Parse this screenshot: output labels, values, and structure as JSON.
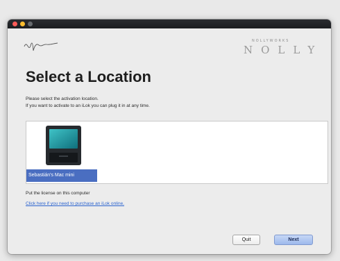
{
  "window": {
    "traffic_lights": [
      "close",
      "minimize",
      "maximize"
    ]
  },
  "brand": {
    "sub": "NOLLYWORKS",
    "name": "NOLLY"
  },
  "dialog": {
    "title": "Select a Location",
    "description_line1": "Please select the activation location.",
    "description_line2": "If you want to activate to an iLok you can plug it in at any time.",
    "locations": [
      {
        "label": "Sebastián's Mac mini",
        "icon": "computer-icon",
        "selected": true
      }
    ],
    "put_license_text": "Put the license on this computer",
    "purchase_link_text": "Click here if you need to purchase an iLok online."
  },
  "buttons": {
    "quit_label": "Quit",
    "next_label": "Next"
  },
  "colors": {
    "selection": "#4a6ec1",
    "link": "#2b63cf",
    "titlebar": "#1e2023"
  }
}
